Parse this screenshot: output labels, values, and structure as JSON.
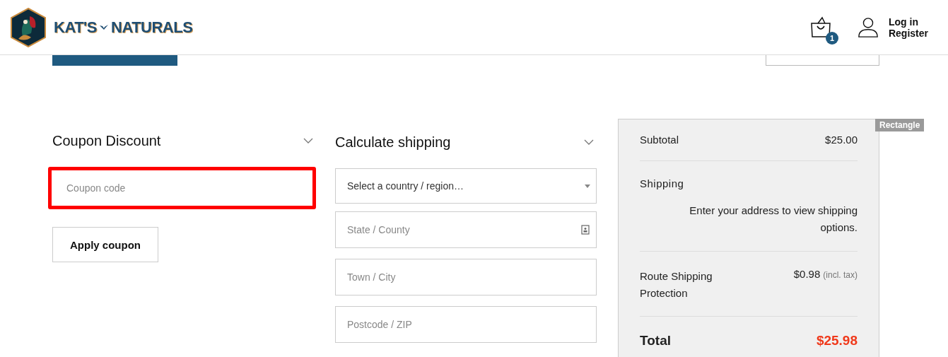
{
  "header": {
    "logo_text": "KAT'S",
    "logo_text_2": "NATURALS",
    "cart_count": "1",
    "account_links": [
      "Log in",
      "Register"
    ]
  },
  "coupon": {
    "title": "Coupon Discount",
    "expanded": true,
    "field": {
      "placeholder": "Coupon code",
      "highlighted": true
    },
    "button": "Apply coupon"
  },
  "shipping_calculator": {
    "title": "Calculate shipping",
    "expanded": true,
    "fields": [
      {
        "kind": "select",
        "value": "Select a country / region…"
      },
      {
        "kind": "input",
        "placeholder": "State / County",
        "contact_icon": true
      },
      {
        "kind": "input",
        "placeholder": "Town / City"
      },
      {
        "kind": "input",
        "placeholder": "Postcode / ZIP"
      }
    ]
  },
  "summary": {
    "rows": [
      {
        "kind": "simple",
        "label": "Subtotal",
        "value": "$25.00"
      },
      {
        "kind": "shipping",
        "label": "Shipping",
        "note": "Enter your address to view shipping options."
      },
      {
        "kind": "simple",
        "label": "Route Shipping Protection",
        "value": "$0.98",
        "suffix": "(incl. tax)"
      },
      {
        "kind": "total",
        "label": "Total",
        "value": "$25.98"
      }
    ]
  },
  "overlay_label": "Rectangle"
}
